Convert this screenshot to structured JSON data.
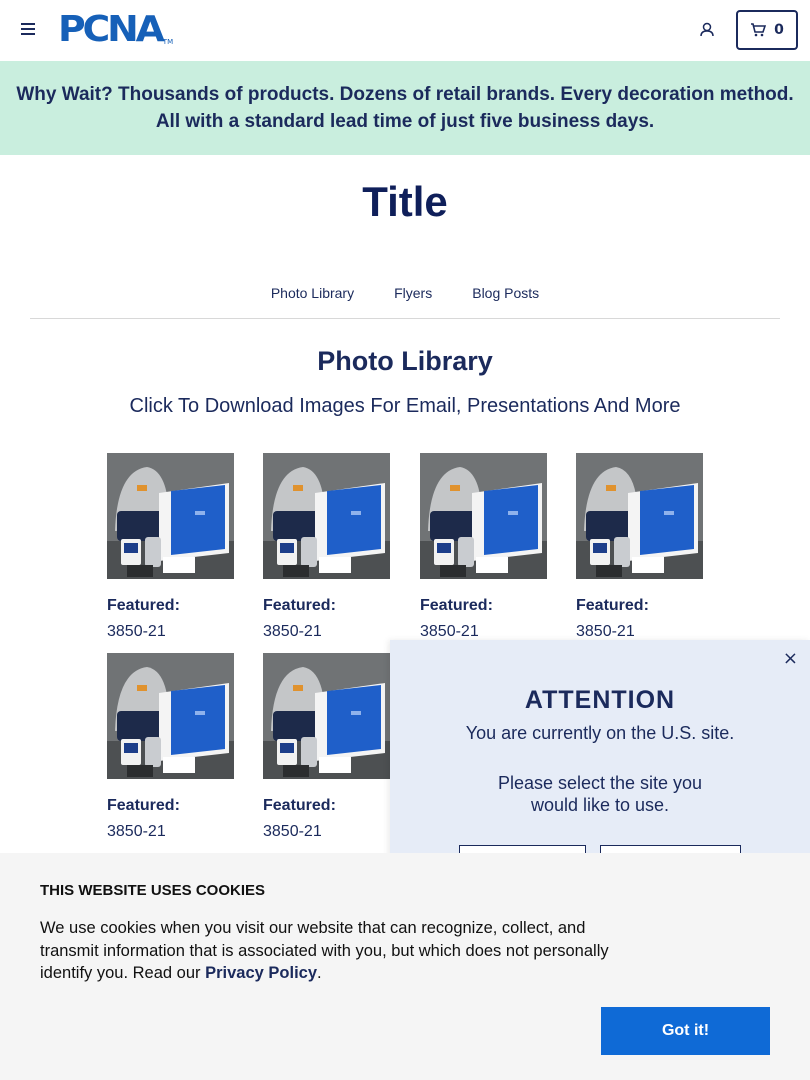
{
  "header": {
    "logo_text": "PCNA",
    "logo_tm": "TM",
    "cart_count": "0"
  },
  "banner": {
    "lead": "Why Wait?",
    "text": " Thousands of products. Dozens of retail brands. Every decoration method. All with a standard lead time of just five business days."
  },
  "page": {
    "title": "Title"
  },
  "tabs": [
    {
      "label": "Photo Library"
    },
    {
      "label": "Flyers"
    },
    {
      "label": "Blog Posts"
    }
  ],
  "section": {
    "title": "Photo Library",
    "subtitle": "Click To Download Images For Email, Presentations And More"
  },
  "photos": [
    {
      "label": "Featured:",
      "sku": "3850-21"
    },
    {
      "label": "Featured:",
      "sku": "3850-21"
    },
    {
      "label": "Featured:",
      "sku": "3850-21"
    },
    {
      "label": "Featured:",
      "sku": "3850-21"
    },
    {
      "label": "Featured:",
      "sku": "3850-21"
    },
    {
      "label": "Featured:",
      "sku": "3850-21"
    }
  ],
  "attention": {
    "title": "ATTENTION",
    "line1": "You are currently on the U.S. site.",
    "line2": "Please select the site you would like to use.",
    "close": "×"
  },
  "cookie": {
    "title": "THIS WEBSITE USES COOKIES",
    "text": "We use cookies when you visit our website that can recognize, collect, and transmit information that is associated with you, but which does not personally identify you. Read our ",
    "link": "Privacy Policy",
    "end": ".",
    "button": "Got it!"
  },
  "colors": {
    "navy": "#1b2a5c",
    "brand_blue": "#1660b8",
    "banner_green": "#c9eede",
    "button_blue": "#0f6ad6"
  }
}
